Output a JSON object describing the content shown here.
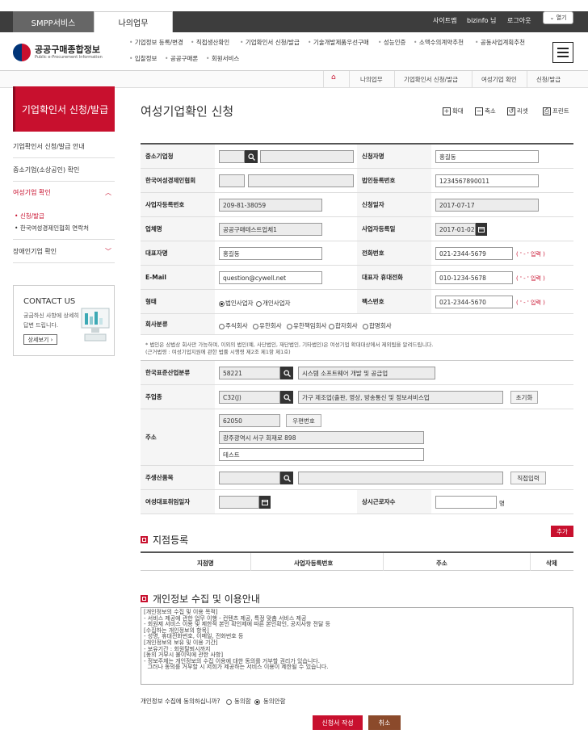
{
  "topbar": {
    "tab_smpp": "SMPP서비스",
    "tab_mywork": "나의업무",
    "links": [
      "사이트맵",
      "bizinfo 님",
      "로그아웃"
    ],
    "open_label": "열기"
  },
  "header": {
    "logo_title": "공공구매종합정보",
    "logo_sub": "Public e-Procurement Information",
    "gnb_row1": [
      "기업정보 등록/변경",
      "직접생산확인",
      "기업확인서 신청/발급",
      "기술개발제품우선구매",
      "성능인증",
      "소액수의계약추천",
      "공동사업계획추천"
    ],
    "gnb_row2": [
      "입찰정보",
      "공공구매론",
      "회원서비스"
    ]
  },
  "breadcrumb": [
    "나의업무",
    "기업확인서 신청/발급",
    "여성기업 확인",
    "신청/발급"
  ],
  "lnb": {
    "title": "기업확인서 신청/발급",
    "items": [
      "기업확인서 신청/발급 안내",
      "중소기업(소상공인) 확인",
      "여성기업 확인",
      "장애인기업 확인"
    ],
    "sub_items": [
      "신청/발급",
      "한국여성경제인협회 연락처"
    ],
    "contact_title": "CONTACT US",
    "contact_text1": "궁금하신 사항에 상세히",
    "contact_text2": "답변 드립니다.",
    "contact_btn": "상세보기"
  },
  "main": {
    "title": "여성기업확인 신청",
    "tools": [
      "확대",
      "축소",
      "리셋",
      "프린트"
    ],
    "labels": {
      "sme": "중소기업청",
      "applicant": "신청자명",
      "assoc": "한국여성경제인협회",
      "corp_no": "법인등록번호",
      "biz_no": "사업자등록번호",
      "apply_date": "신청일자",
      "company": "업체명",
      "biz_reg_date": "사업자등록일",
      "ceo": "대표자명",
      "phone": "전화번호",
      "email": "E-Mail",
      "ceo_mobile": "대표자 휴대전화",
      "form": "형태",
      "fax": "팩스번호",
      "corp_type": "회사분류",
      "ksic": "한국표준산업분류",
      "main_industry": "주업종",
      "address": "주소",
      "main_product": "주생산품목",
      "ceo_date": "여성대표취임일자",
      "workers": "상시근로자수"
    },
    "values": {
      "applicant": "홍길동",
      "corp_no": "1234567890011",
      "biz_no": "209-81-38059",
      "apply_date": "2017-07-17",
      "company": "공공구매테스트업체1",
      "biz_reg_date": "2017-01-02",
      "ceo": "홍길동",
      "phone": "021-2344-5679",
      "email": "question@cywell.net",
      "ceo_mobile": "010-1234-5678",
      "fax": "021-2344-5670",
      "ksic_code": "58221",
      "ksic_name": "시스템 소프트웨어 개발 및 공급업",
      "industry_code": "C32(J)",
      "industry_name": "가구 제조업(출판, 영상, 방송통신 및 정보서비스업",
      "zip": "62050",
      "addr1": "광주광역시 서구 회재로 898",
      "addr2": "테스트",
      "workers_unit": "명"
    },
    "phone_hint": "( ' - ' 입력 )",
    "radios_form": [
      "법인사업자",
      "개인사업자"
    ],
    "radios_corp": [
      "주식회사",
      "유한회사",
      "유한책임회사",
      "합자회사",
      "합명회사"
    ],
    "notice1": "* 법인은 상법상 회사만 가능하며, 이외의 법인(예, 사단법인, 재단법인, 기타법인)은 여성기업 확대대상에서 제외됨을 알려드립니다.",
    "notice2": "(근거법령 : 여성기업지원에 관한 법률 시행령 제2조 제1항 제1호)",
    "btn_zip": "우편번호",
    "btn_reset": "초기화",
    "btn_direct": "직접입력"
  },
  "branch": {
    "title": "지점등록",
    "add_btn": "추가",
    "cols": [
      "지점명",
      "사업자등록번호",
      "주소",
      "삭제"
    ]
  },
  "privacy": {
    "title": "개인정보 수집 및 이용안내",
    "lines": [
      "[개인정보의 수집 및 이용 목적]",
      "- 서비스 제공에 관한 업무 이행 - 컨텐츠 제공, 특정 맞춤 서비스 제공",
      "- 회원제 서비스 이용 및 제한적 본인 확인제에 따른 본인확인, 공지사항 전달 등",
      "[수집하는 개인정보의 항목]",
      "- 성명, 휴대전화번호, 이메일, 전화번호 등",
      "[개인정보의 보유 및 이용 기간]",
      "- 보유기간 : 회원탈퇴시까지",
      "[동의 거부시 불이익에 관한 사항]",
      "- 정보주체는 개인정보의 수집 이용에 대한 동의를 거부할 권리가 있습니다.",
      "  그러나 동의를 거부할 시 저희가 제공하는 서비스 이용이 제한될 수 있습니다."
    ],
    "agree_q": "개인정보 수집에 동의하십니까?",
    "agree": "동의함",
    "disagree": "동의안함"
  },
  "footer": {
    "apply": "신청서 작성",
    "cancel": "취소"
  }
}
